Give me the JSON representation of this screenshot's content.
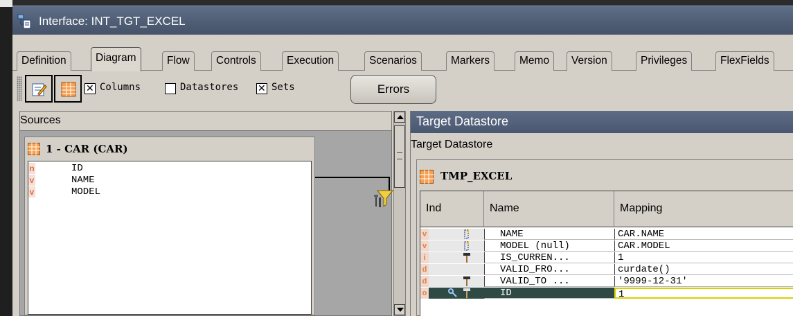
{
  "window": {
    "title": "Interface: INT_TGT_EXCEL"
  },
  "tabs": [
    {
      "label": "Definition",
      "active": false
    },
    {
      "label": "Diagram",
      "active": true
    },
    {
      "label": "Flow",
      "active": false
    },
    {
      "label": "Controls",
      "active": false
    },
    {
      "label": "Execution",
      "active": false
    },
    {
      "label": "Scenarios",
      "active": false
    },
    {
      "label": "Markers",
      "active": false
    },
    {
      "label": "Memo",
      "active": false
    },
    {
      "label": "Version",
      "active": false
    },
    {
      "label": "Privileges",
      "active": false
    },
    {
      "label": "FlexFields",
      "active": false
    }
  ],
  "toolbar": {
    "columns": {
      "label": "Columns",
      "checked": true
    },
    "datastores": {
      "label": "Datastores",
      "checked": false
    },
    "sets": {
      "label": "Sets",
      "checked": true
    },
    "errors_label": "Errors"
  },
  "sources": {
    "header": "Sources",
    "datastore_title": "1 - CAR (CAR)",
    "columns": [
      {
        "type": "n",
        "name": "ID"
      },
      {
        "type": "v",
        "name": "NAME"
      },
      {
        "type": "v",
        "name": "MODEL"
      }
    ]
  },
  "target": {
    "header": "Target Datastore",
    "subheader": "Target Datastore",
    "datastore_title": "TMP_EXCEL",
    "grid_headers": {
      "ind": "Ind",
      "name": "Name",
      "mapping": "Mapping"
    },
    "rows": [
      {
        "type": "v",
        "icon": "target-column-icon",
        "name": "NAME",
        "mapping": "CAR.NAME",
        "selected": false
      },
      {
        "type": "v",
        "icon": "target-column-icon",
        "name": "MODEL (null)",
        "mapping": "CAR.MODEL",
        "selected": false
      },
      {
        "type": "i",
        "icon": "staging-hammer-icon",
        "name": "IS_CURREN...",
        "mapping": "1",
        "selected": false
      },
      {
        "type": "d",
        "icon": "",
        "name": "VALID_FRO...",
        "mapping": "curdate()",
        "selected": false
      },
      {
        "type": "d",
        "icon": "staging-hammer-icon",
        "name": "VALID_TO ...",
        "mapping": "'9999-12-31'",
        "selected": false
      },
      {
        "type": "o",
        "icon": "key-hammer-icon",
        "name": "ID",
        "mapping": "1",
        "selected": true
      }
    ]
  },
  "colors": {
    "titlebar": "#4e5c74",
    "panel_bg": "#d4d0c8",
    "type_marker": "#e07040",
    "selected_row": "#2f4a45",
    "mapping_focus": "#d8d000"
  }
}
